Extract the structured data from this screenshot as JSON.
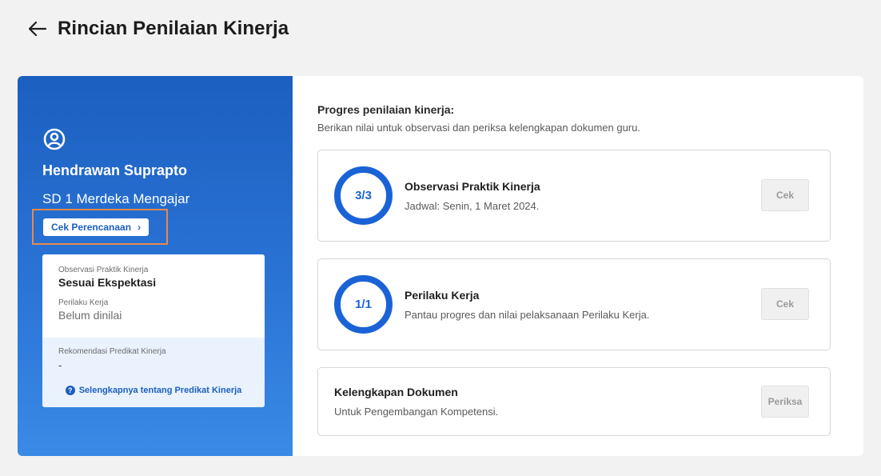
{
  "header": {
    "title": "Rincian Penilaian Kinerja"
  },
  "profile": {
    "name": "Hendrawan Suprapto",
    "school": "SD 1 Merdeka Mengajar",
    "plan_button": "Cek Perencanaan"
  },
  "summary": {
    "observasi_label": "Observasi Praktik Kinerja",
    "observasi_value": "Sesuai Ekspektasi",
    "perilaku_label": "Perilaku Kerja",
    "perilaku_value": "Belum dinilai",
    "rekomendasi_label": "Rekomendasi Predikat Kinerja",
    "rekomendasi_value": "-",
    "more_link": "Selengkapnya tentang Predikat Kinerja"
  },
  "progress": {
    "title": "Progres penilaian kinerja:",
    "subtitle": "Berikan nilai untuk observasi dan periksa kelengkapan dokumen guru."
  },
  "tasks": [
    {
      "ring": "3/3",
      "title": "Observasi Praktik Kinerja",
      "desc": "Jadwal: Senin, 1 Maret 2024.",
      "button": "Cek"
    },
    {
      "ring": "1/1",
      "title": "Perilaku Kerja",
      "desc": "Pantau progres dan nilai pelaksanaan Perilaku Kerja.",
      "button": "Cek"
    },
    {
      "title": "Kelengkapan Dokumen",
      "desc": "Untuk Pengembangan Kompetensi.",
      "button": "Periksa"
    }
  ],
  "colors": {
    "primary": "#1a63d6",
    "highlight": "#e88a4a",
    "background": "#f2f2f2"
  },
  "icons": {
    "back": "arrow-left-icon",
    "user": "user-circle-icon",
    "help": "question-circle-icon",
    "chevron": "chevron-right-icon"
  }
}
